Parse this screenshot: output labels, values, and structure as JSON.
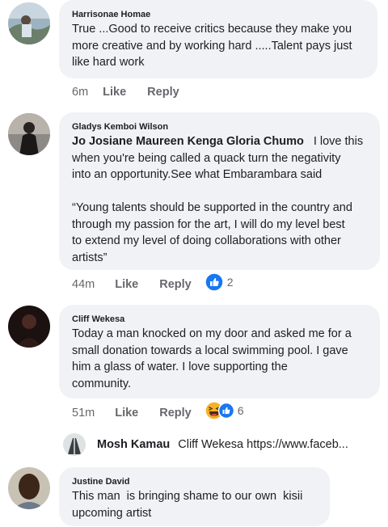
{
  "comments": [
    {
      "author": "Harrisonae Homae",
      "lines": [
        "True ...Good to receive critics because they make you",
        "more creative and by working hard .....Talent pays just",
        "like hard work"
      ],
      "time": "6m",
      "like": "Like",
      "reply": "Reply"
    },
    {
      "author": "Gladys Kemboi Wilson",
      "tag": "Jo Josiane Maureen Kenga Gloria Chumo",
      "lines": [
        "I love this",
        "when you're being called a quack turn the negativity",
        "into an opportunity.See what Embarambara said",
        "",
        "“Young talents should be supported in the country and",
        "through my passion for the art, I will do my level best",
        "to extend my level of doing collaborations with other",
        "artists”"
      ],
      "time": "44m",
      "like": "Like",
      "reply": "Reply",
      "reactions": "2"
    },
    {
      "author": "Cliff Wekesa",
      "lines": [
        "Today a man knocked on my door and asked me for a",
        "small donation towards a local swimming pool. I gave",
        "him a glass of water. I love supporting the",
        "community."
      ],
      "time": "51m",
      "like": "Like",
      "reply": "Reply",
      "reactions": "6"
    },
    {
      "author": "Justine David",
      "lines": [
        "This man  is bringing shame to our own  kisii",
        "upcoming artist"
      ]
    }
  ],
  "reply_preview": {
    "author": "Mosh Kamau",
    "text": "Cliff Wekesa https://www.faceb..."
  },
  "colors": {
    "bubble": "#f0f2f5",
    "like_blue": "#1877f2",
    "haha_yellow": "#f7b125",
    "meta": "#65676b"
  }
}
